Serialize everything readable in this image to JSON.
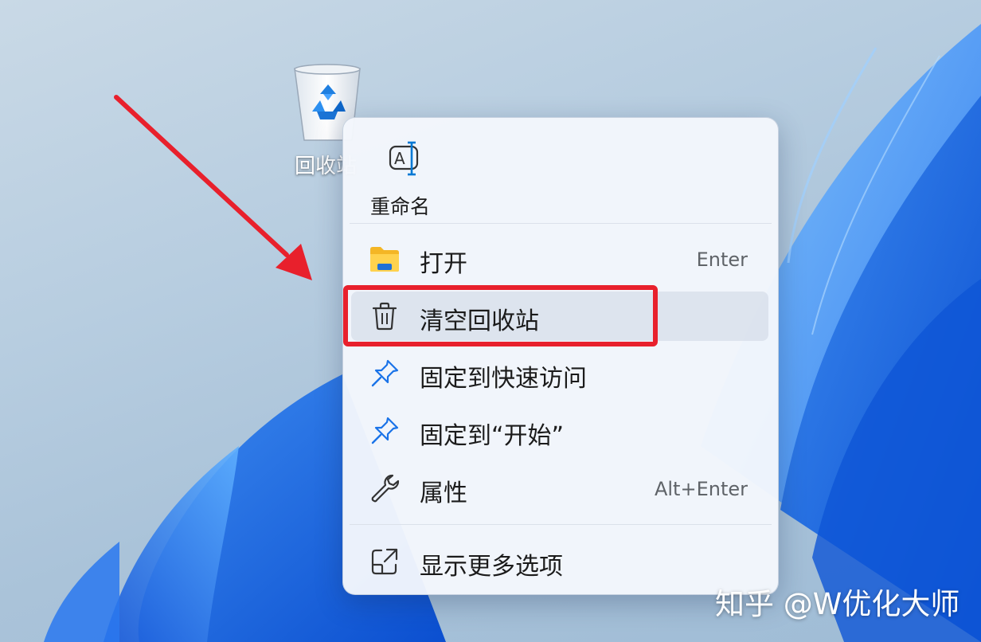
{
  "desktop": {
    "recycle_bin_label": "回收站",
    "watermark": "知乎 @W优化大师"
  },
  "context_menu": {
    "rename_label": "重命名",
    "items": [
      {
        "label": "打开",
        "shortcut": "Enter",
        "icon": "folder-icon"
      },
      {
        "label": "清空回收站",
        "shortcut": "",
        "icon": "trash-icon",
        "highlighted": true
      },
      {
        "label": "固定到快速访问",
        "shortcut": "",
        "icon": "pin-icon"
      },
      {
        "label": "固定到“开始”",
        "shortcut": "",
        "icon": "pin-icon"
      },
      {
        "label": "属性",
        "shortcut": "Alt+Enter",
        "icon": "wrench-icon"
      },
      {
        "label": "显示更多选项",
        "shortcut": "",
        "icon": "share-icon"
      }
    ]
  },
  "colors": {
    "annotation_red": "#e8202c",
    "accent_blue": "#0078d4"
  }
}
